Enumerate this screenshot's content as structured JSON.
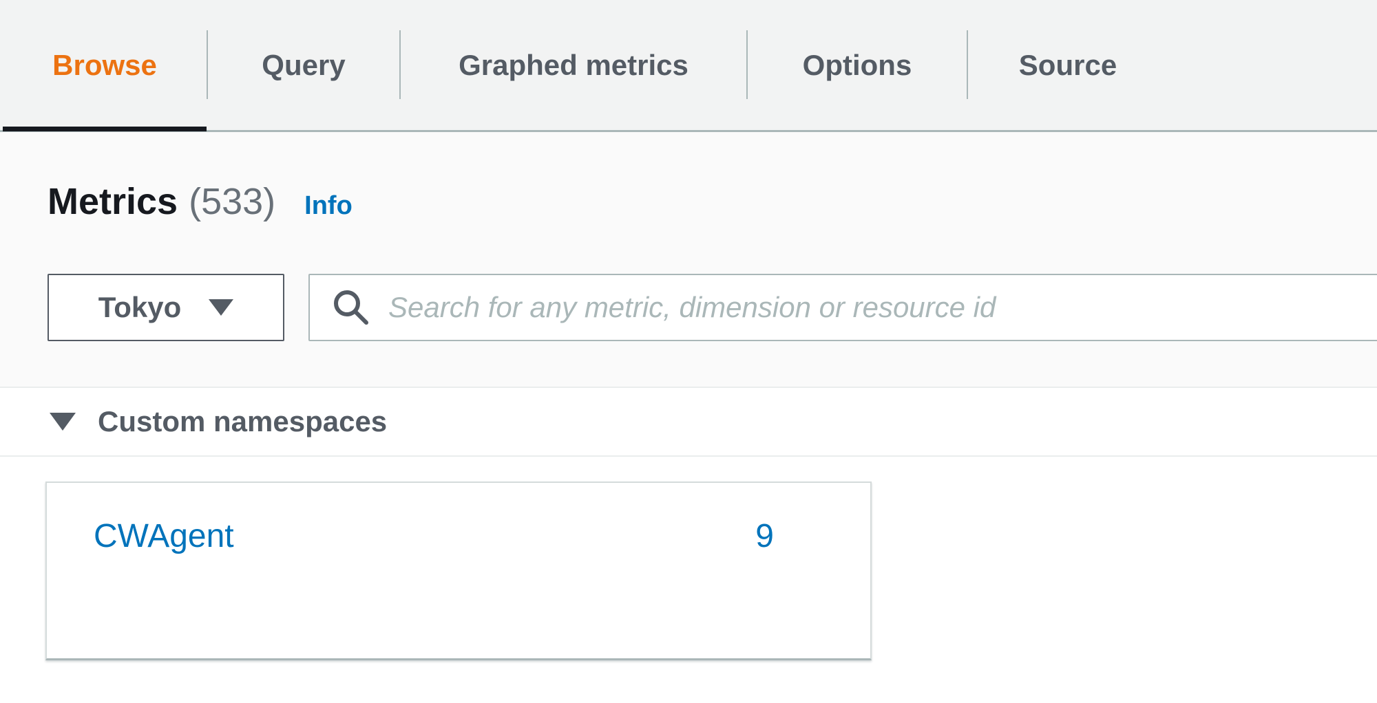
{
  "tabs": [
    {
      "label": "Browse",
      "active": true
    },
    {
      "label": "Query",
      "active": false
    },
    {
      "label": "Graphed metrics",
      "active": false
    },
    {
      "label": "Options",
      "active": false
    },
    {
      "label": "Source",
      "active": false
    }
  ],
  "metrics": {
    "title": "Metrics",
    "count": "(533)",
    "info_label": "Info"
  },
  "region": {
    "selected": "Tokyo"
  },
  "search": {
    "placeholder": "Search for any metric, dimension or resource id",
    "value": ""
  },
  "namespaces": {
    "section_title": "Custom namespaces",
    "items": [
      {
        "name": "CWAgent",
        "count": "9"
      }
    ]
  },
  "colors": {
    "active_tab": "#ec7211",
    "link": "#0073bb",
    "text": "#16191f",
    "muted": "#545b64"
  }
}
